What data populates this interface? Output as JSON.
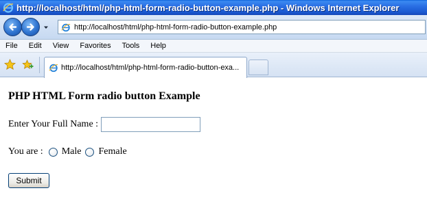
{
  "window": {
    "title": "http://localhost/html/php-html-form-radio-button-example.php - Windows Internet Explorer"
  },
  "address_bar": {
    "url": "http://localhost/html/php-html-form-radio-button-example.php"
  },
  "menu": {
    "items": [
      "File",
      "Edit",
      "View",
      "Favorites",
      "Tools",
      "Help"
    ]
  },
  "tabs": [
    {
      "label": "http://localhost/html/php-html-form-radio-button-exa...",
      "active": true
    }
  ],
  "page": {
    "heading": "PHP HTML Form radio button Example",
    "name_label": "Enter Your Full Name :",
    "name_value": "",
    "sex_label": "You are :",
    "radio_options": [
      {
        "label": "Male",
        "checked": false
      },
      {
        "label": "Female",
        "checked": false
      }
    ],
    "submit_label": "Submit"
  },
  "colors": {
    "titlebar": "#2a6fe4",
    "toolbar": "#dde9f8"
  }
}
